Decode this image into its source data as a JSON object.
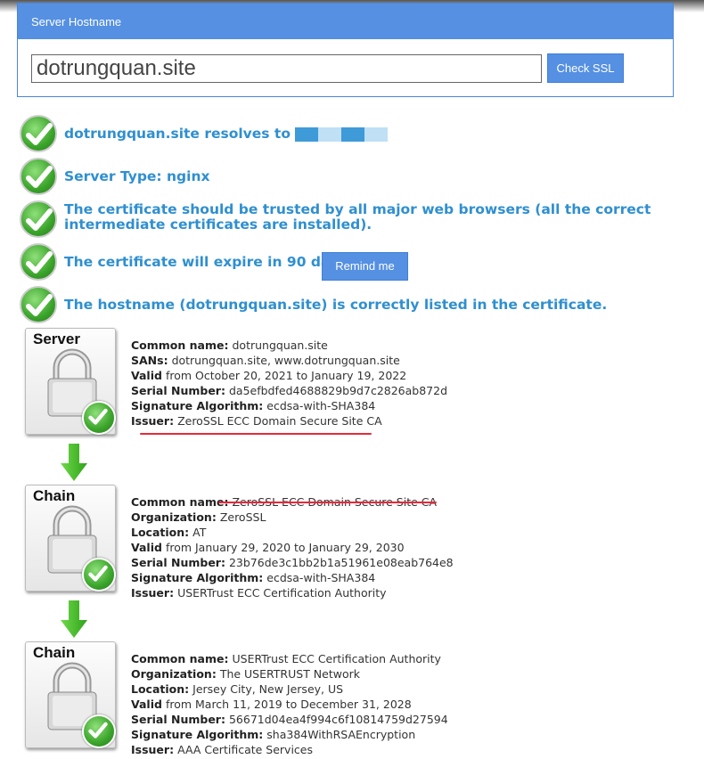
{
  "form": {
    "header": "Server Hostname",
    "hostname_value": "dotrungquan.site",
    "check_button": "Check SSL"
  },
  "results": [
    {
      "text": "dotrungquan.site resolves to",
      "redacted": true
    },
    {
      "text": "Server Type: nginx"
    },
    {
      "text": "The certificate should be trusted by all major web browsers (all the correct intermediate certificates are installed)."
    },
    {
      "text": "The certificate will expire in 90 days.",
      "button": "Remind me"
    },
    {
      "text": "The hostname (dotrungquan.site) is correctly listed in the certificate."
    }
  ],
  "chain": [
    {
      "label": "Server",
      "fields": [
        {
          "k": "Common name:",
          "v": "dotrungquan.site"
        },
        {
          "k": "SANs:",
          "v": "dotrungquan.site, www.dotrungquan.site"
        },
        {
          "k": "Valid",
          "v": "from October 20, 2021 to January 19, 2022"
        },
        {
          "k": "Serial Number:",
          "v": "da5efbdfed4688829b9d7c2826ab872d"
        },
        {
          "k": "Signature Algorithm:",
          "v": "ecdsa-with-SHA384"
        },
        {
          "k": "Issuer:",
          "v": "ZeroSSL ECC Domain Secure Site CA"
        }
      ]
    },
    {
      "label": "Chain",
      "fields": [
        {
          "k": "Common name:",
          "v": "ZeroSSL ECC Domain Secure Site CA"
        },
        {
          "k": "Organization:",
          "v": "ZeroSSL"
        },
        {
          "k": "Location:",
          "v": "AT"
        },
        {
          "k": "Valid",
          "v": "from January 29, 2020 to January 29, 2030"
        },
        {
          "k": "Serial Number:",
          "v": "23b76de3c1bb2b1a51961e08eab764e8"
        },
        {
          "k": "Signature Algorithm:",
          "v": "ecdsa-with-SHA384"
        },
        {
          "k": "Issuer:",
          "v": "USERTrust ECC Certification Authority"
        }
      ]
    },
    {
      "label": "Chain",
      "fields": [
        {
          "k": "Common name:",
          "v": "USERTrust ECC Certification Authority"
        },
        {
          "k": "Organization:",
          "v": "The USERTRUST Network"
        },
        {
          "k": "Location:",
          "v": "Jersey City, New Jersey, US"
        },
        {
          "k": "Valid",
          "v": "from March 11, 2019 to December 31, 2028"
        },
        {
          "k": "Serial Number:",
          "v": "56671d04ea4f994c6f10814759d27594"
        },
        {
          "k": "Signature Algorithm:",
          "v": "sha384WithRSAEncryption"
        },
        {
          "k": "Issuer:",
          "v": "AAA Certificate Services"
        }
      ]
    }
  ],
  "colors": {
    "accent": "#5590e2",
    "result_text": "#2f8fd0",
    "highlight": "#e8283a"
  }
}
